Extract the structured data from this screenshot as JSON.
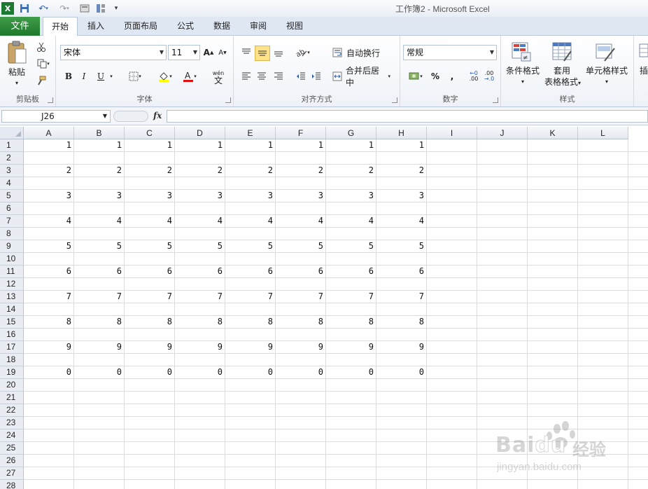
{
  "window": {
    "title": "工作簿2 - Microsoft Excel"
  },
  "tabs": [
    {
      "label": "文件",
      "active": false
    },
    {
      "label": "开始",
      "active": true
    },
    {
      "label": "插入",
      "active": false
    },
    {
      "label": "页面布局",
      "active": false
    },
    {
      "label": "公式",
      "active": false
    },
    {
      "label": "数据",
      "active": false
    },
    {
      "label": "审阅",
      "active": false
    },
    {
      "label": "视图",
      "active": false
    }
  ],
  "ribbon": {
    "clipboard": {
      "label": "剪贴板",
      "paste": "粘贴"
    },
    "font": {
      "label": "字体",
      "name": "宋体",
      "size": "11",
      "bold": "B",
      "italic": "I",
      "underline": "U",
      "wen": "wén"
    },
    "alignment": {
      "label": "对齐方式",
      "wrap": "自动换行",
      "merge": "合并后居中"
    },
    "number": {
      "label": "数字",
      "format": "常规",
      "percent": "%",
      "comma": ",",
      "inc": ".00",
      "dec": ".0"
    },
    "styles": {
      "label": "样式",
      "conditional": "条件格式",
      "table_format_1": "套用",
      "table_format_2": "表格格式",
      "cell_styles": "单元格样式"
    },
    "insert_partial": "插"
  },
  "formula_bar": {
    "name_box": "J26",
    "fx": "fx",
    "value": ""
  },
  "sheet": {
    "columns": [
      "A",
      "B",
      "C",
      "D",
      "E",
      "F",
      "G",
      "H",
      "I",
      "J",
      "K",
      "L"
    ],
    "rows": [
      "1",
      "2",
      "3",
      "4",
      "5",
      "6",
      "7",
      "8",
      "9",
      "10",
      "11",
      "12",
      "13",
      "14",
      "15",
      "16",
      "17",
      "18",
      "19",
      "20",
      "21",
      "22",
      "23",
      "24",
      "25",
      "26",
      "27",
      "28"
    ],
    "data_rows": [
      {
        "row": "1",
        "values": [
          "1",
          "1",
          "1",
          "1",
          "1",
          "1",
          "1",
          "1"
        ]
      },
      {
        "row": "3",
        "values": [
          "2",
          "2",
          "2",
          "2",
          "2",
          "2",
          "2",
          "2"
        ]
      },
      {
        "row": "5",
        "values": [
          "3",
          "3",
          "3",
          "3",
          "3",
          "3",
          "3",
          "3"
        ]
      },
      {
        "row": "7",
        "values": [
          "4",
          "4",
          "4",
          "4",
          "4",
          "4",
          "4",
          "4"
        ]
      },
      {
        "row": "9",
        "values": [
          "5",
          "5",
          "5",
          "5",
          "5",
          "5",
          "5",
          "5"
        ]
      },
      {
        "row": "11",
        "values": [
          "6",
          "6",
          "6",
          "6",
          "6",
          "6",
          "6",
          "6"
        ]
      },
      {
        "row": "13",
        "values": [
          "7",
          "7",
          "7",
          "7",
          "7",
          "7",
          "7",
          "7"
        ]
      },
      {
        "row": "15",
        "values": [
          "8",
          "8",
          "8",
          "8",
          "8",
          "8",
          "8",
          "8"
        ]
      },
      {
        "row": "17",
        "values": [
          "9",
          "9",
          "9",
          "9",
          "9",
          "9",
          "9",
          "9"
        ]
      },
      {
        "row": "19",
        "values": [
          "0",
          "0",
          "0",
          "0",
          "0",
          "0",
          "0",
          "0"
        ]
      }
    ]
  },
  "watermark": {
    "brand": "Bai",
    "brand2": "du",
    "cn": "经验",
    "url": "jingyan.baidu.com"
  },
  "colors": {
    "file_tab": "#1f7a2d",
    "grid": "#dadcdd",
    "header_bg": "#e4e9f1"
  }
}
